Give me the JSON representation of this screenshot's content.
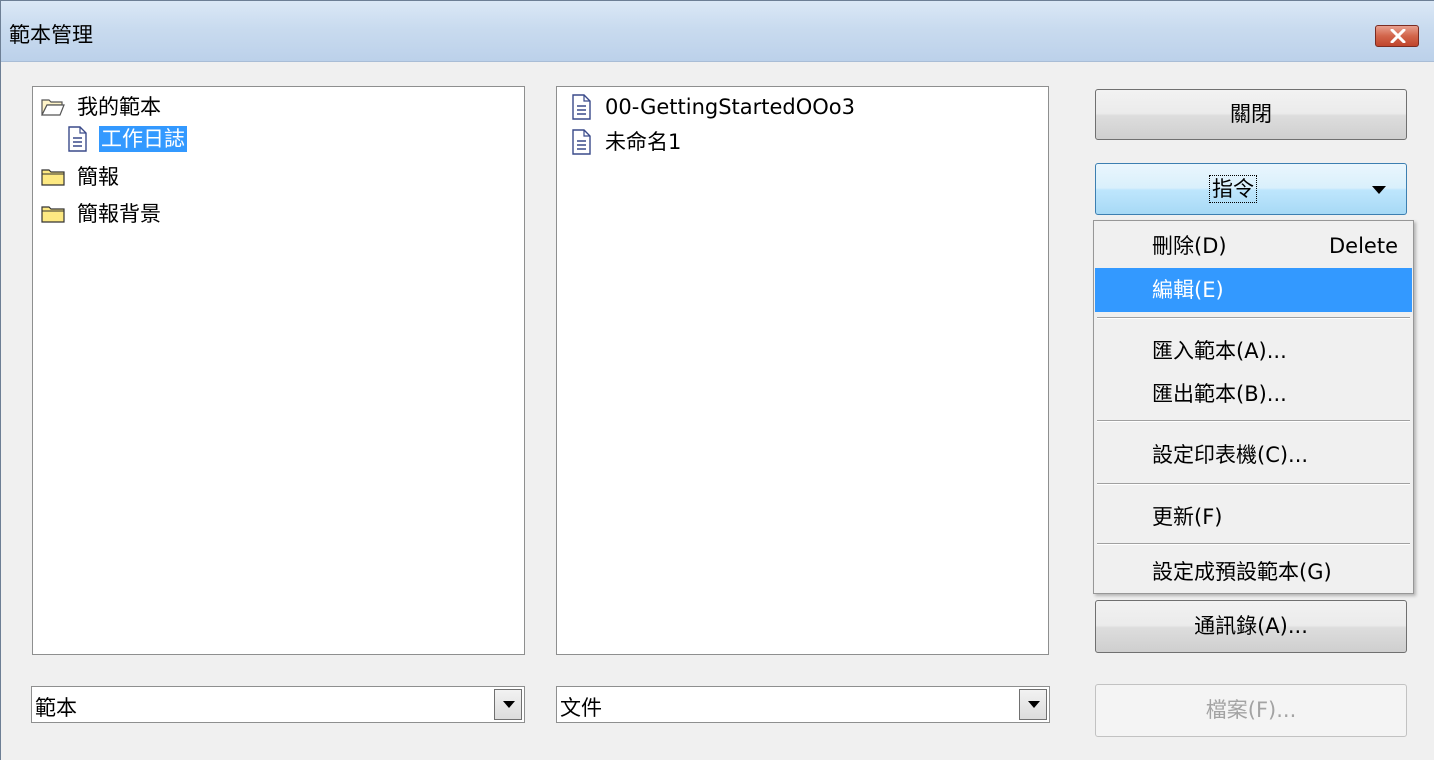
{
  "window": {
    "title": "範本管理"
  },
  "tree": {
    "items": [
      {
        "label": "我的範本",
        "icon": "folder-open-icon"
      },
      {
        "label": "工作日誌",
        "icon": "document-icon",
        "selected": true
      },
      {
        "label": "簡報",
        "icon": "folder-icon"
      },
      {
        "label": "簡報背景",
        "icon": "folder-icon"
      }
    ]
  },
  "documents": {
    "items": [
      {
        "label": "00-GettingStartedOOo3",
        "icon": "document-icon"
      },
      {
        "label": "未命名1",
        "icon": "document-icon"
      }
    ]
  },
  "combos": {
    "left_value": "範本",
    "right_value": "文件"
  },
  "buttons": {
    "close": "關閉",
    "commands": "指令",
    "address_book": "通訊錄(A)...",
    "file": "檔案(F)..."
  },
  "menu": {
    "items": [
      {
        "label": "刪除(D)",
        "shortcut": "Delete"
      },
      {
        "label": "編輯(E)",
        "highlighted": true
      },
      {
        "label": "匯入範本(A)..."
      },
      {
        "label": "匯出範本(B)..."
      },
      {
        "label": "設定印表機(C)..."
      },
      {
        "label": "更新(F)"
      },
      {
        "label": "設定成預設範本(G)"
      }
    ]
  },
  "colors": {
    "selection": "#3399ff",
    "titlebar": "#c9dbef",
    "close_button": "#c7503a"
  }
}
